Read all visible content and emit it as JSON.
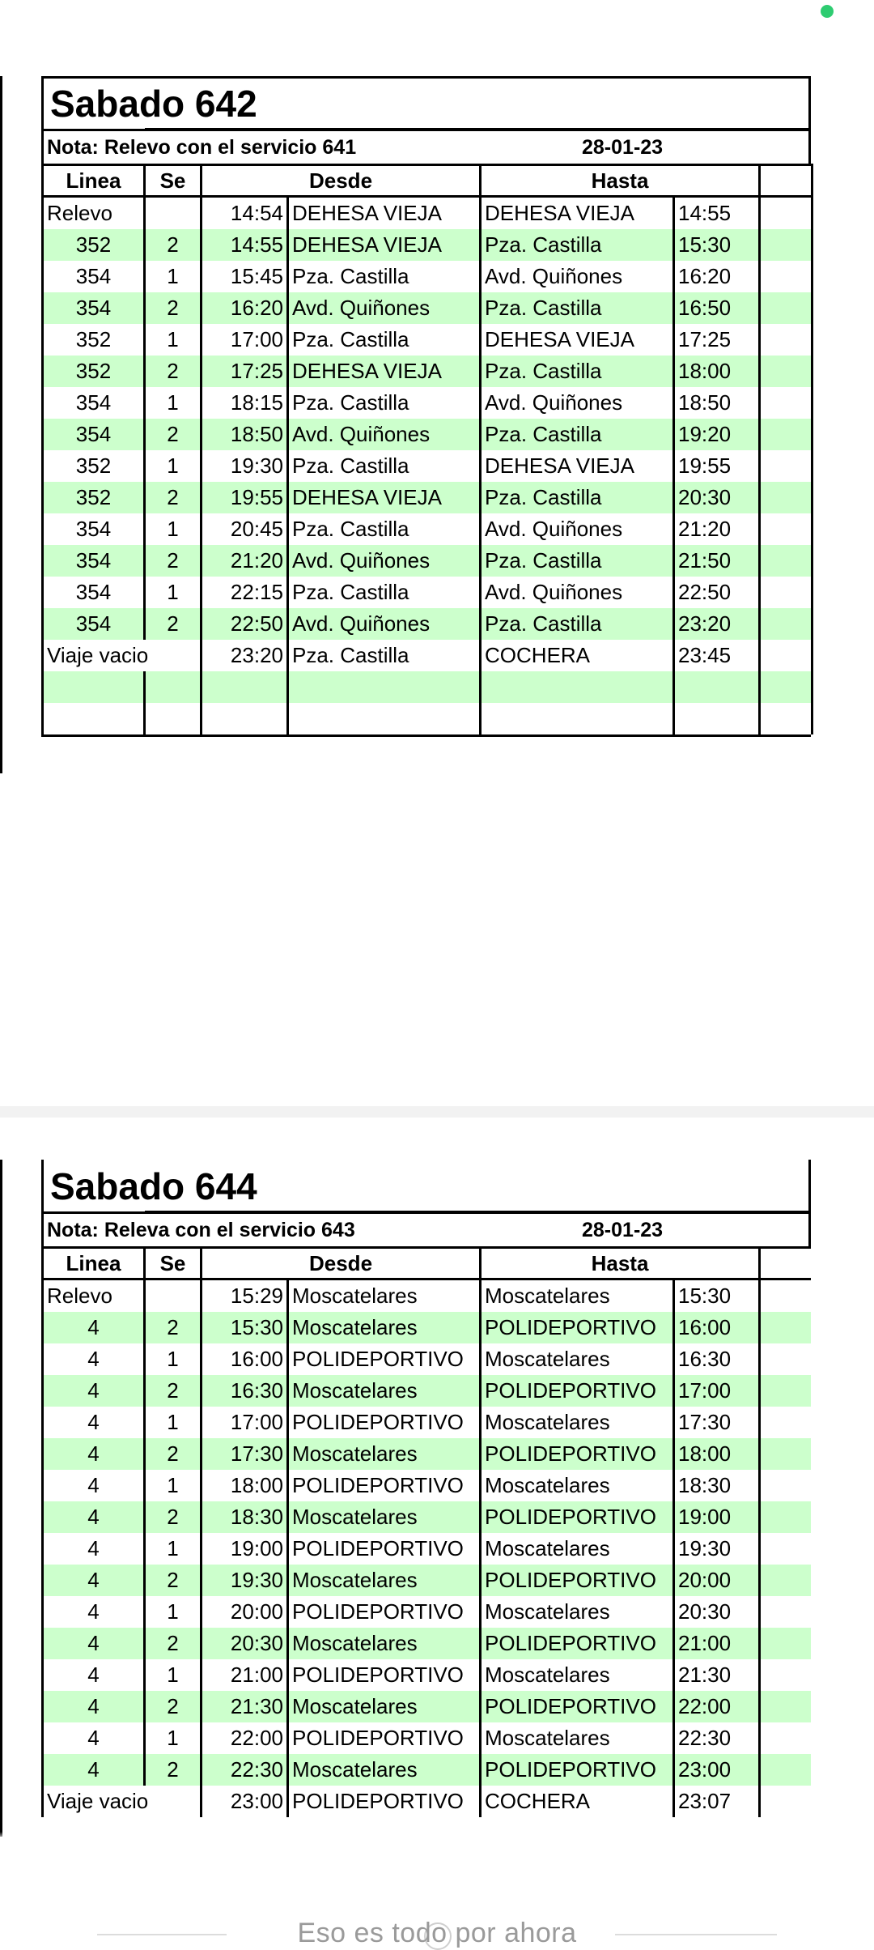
{
  "headers": {
    "linea": "Linea",
    "se": "Se",
    "desde": "Desde",
    "hasta": "Hasta"
  },
  "sheet1": {
    "title": "Sabado 642",
    "note": "Nota: Relevo con el servicio 641",
    "date": "28-01-23",
    "first_row": {
      "label": "Relevo",
      "time": "14:54",
      "from": "DEHESA VIEJA",
      "to": "DEHESA VIEJA",
      "end": "14:55"
    },
    "rows": [
      {
        "line": "352",
        "se": "2",
        "time": "14:55",
        "from": "DEHESA VIEJA",
        "to": "Pza. Castilla",
        "end": "15:30"
      },
      {
        "line": "354",
        "se": "1",
        "time": "15:45",
        "from": "Pza. Castilla",
        "to": "Avd. Quiñones",
        "end": "16:20"
      },
      {
        "line": "354",
        "se": "2",
        "time": "16:20",
        "from": "Avd. Quiñones",
        "to": "Pza. Castilla",
        "end": "16:50"
      },
      {
        "line": "352",
        "se": "1",
        "time": "17:00",
        "from": "Pza. Castilla",
        "to": "DEHESA VIEJA",
        "end": "17:25"
      },
      {
        "line": "352",
        "se": "2",
        "time": "17:25",
        "from": "DEHESA VIEJA",
        "to": "Pza. Castilla",
        "end": "18:00"
      },
      {
        "line": "354",
        "se": "1",
        "time": "18:15",
        "from": "Pza. Castilla",
        "to": "Avd. Quiñones",
        "end": "18:50"
      },
      {
        "line": "354",
        "se": "2",
        "time": "18:50",
        "from": "Avd. Quiñones",
        "to": "Pza. Castilla",
        "end": "19:20"
      },
      {
        "line": "352",
        "se": "1",
        "time": "19:30",
        "from": "Pza. Castilla",
        "to": "DEHESA VIEJA",
        "end": "19:55"
      },
      {
        "line": "352",
        "se": "2",
        "time": "19:55",
        "from": "DEHESA VIEJA",
        "to": "Pza. Castilla",
        "end": "20:30"
      },
      {
        "line": "354",
        "se": "1",
        "time": "20:45",
        "from": "Pza. Castilla",
        "to": "Avd. Quiñones",
        "end": "21:20"
      },
      {
        "line": "354",
        "se": "2",
        "time": "21:20",
        "from": "Avd. Quiñones",
        "to": "Pza. Castilla",
        "end": "21:50"
      },
      {
        "line": "354",
        "se": "1",
        "time": "22:15",
        "from": "Pza. Castilla",
        "to": "Avd. Quiñones",
        "end": "22:50"
      },
      {
        "line": "354",
        "se": "2",
        "time": "22:50",
        "from": "Avd. Quiñones",
        "to": "Pza. Castilla",
        "end": "23:20"
      }
    ],
    "last_row": {
      "label": "Viaje vacio",
      "time": "23:20",
      "from": "Pza. Castilla",
      "to": "COCHERA",
      "end": "23:45"
    }
  },
  "sheet2": {
    "title": "Sabado 644",
    "note": "Nota: Releva con el servicio 643",
    "date": "28-01-23",
    "first_row": {
      "label": "Relevo",
      "time": "15:29",
      "from": "Moscatelares",
      "to": "Moscatelares",
      "end": "15:30"
    },
    "rows": [
      {
        "line": "4",
        "se": "2",
        "time": "15:30",
        "from": "Moscatelares",
        "to": "POLIDEPORTIVO",
        "end": "16:00"
      },
      {
        "line": "4",
        "se": "1",
        "time": "16:00",
        "from": "POLIDEPORTIVO",
        "to": "Moscatelares",
        "end": "16:30"
      },
      {
        "line": "4",
        "se": "2",
        "time": "16:30",
        "from": "Moscatelares",
        "to": "POLIDEPORTIVO",
        "end": "17:00"
      },
      {
        "line": "4",
        "se": "1",
        "time": "17:00",
        "from": "POLIDEPORTIVO",
        "to": "Moscatelares",
        "end": "17:30"
      },
      {
        "line": "4",
        "se": "2",
        "time": "17:30",
        "from": "Moscatelares",
        "to": "POLIDEPORTIVO",
        "end": "18:00"
      },
      {
        "line": "4",
        "se": "1",
        "time": "18:00",
        "from": "POLIDEPORTIVO",
        "to": "Moscatelares",
        "end": "18:30"
      },
      {
        "line": "4",
        "se": "2",
        "time": "18:30",
        "from": "Moscatelares",
        "to": "POLIDEPORTIVO",
        "end": "19:00"
      },
      {
        "line": "4",
        "se": "1",
        "time": "19:00",
        "from": "POLIDEPORTIVO",
        "to": "Moscatelares",
        "end": "19:30"
      },
      {
        "line": "4",
        "se": "2",
        "time": "19:30",
        "from": "Moscatelares",
        "to": "POLIDEPORTIVO",
        "end": "20:00"
      },
      {
        "line": "4",
        "se": "1",
        "time": "20:00",
        "from": "POLIDEPORTIVO",
        "to": "Moscatelares",
        "end": "20:30"
      },
      {
        "line": "4",
        "se": "2",
        "time": "20:30",
        "from": "Moscatelares",
        "to": "POLIDEPORTIVO",
        "end": "21:00"
      },
      {
        "line": "4",
        "se": "1",
        "time": "21:00",
        "from": "POLIDEPORTIVO",
        "to": "Moscatelares",
        "end": "21:30"
      },
      {
        "line": "4",
        "se": "2",
        "time": "21:30",
        "from": "Moscatelares",
        "to": "POLIDEPORTIVO",
        "end": "22:00"
      },
      {
        "line": "4",
        "se": "1",
        "time": "22:00",
        "from": "POLIDEPORTIVO",
        "to": "Moscatelares",
        "end": "22:30"
      },
      {
        "line": "4",
        "se": "2",
        "time": "22:30",
        "from": "Moscatelares",
        "to": "POLIDEPORTIVO",
        "end": "23:00"
      }
    ],
    "last_row": {
      "label": "Viaje vacio",
      "time": "23:00",
      "from": "POLIDEPORTIVO",
      "to": "COCHERA",
      "end": "23:07"
    }
  },
  "footer": {
    "text": "Eso es todo por ahora"
  },
  "colors": {
    "row_highlight": "#ccffcc",
    "status_dot": "#2ecc71"
  }
}
